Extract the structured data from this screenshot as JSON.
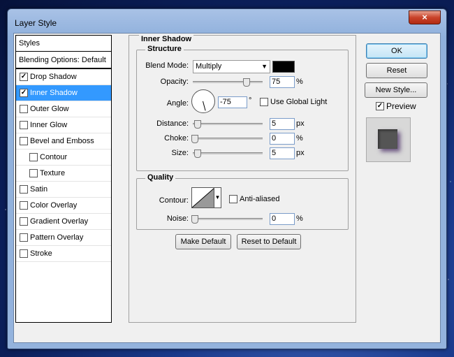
{
  "window": {
    "title": "Layer Style",
    "close_glyph": "×"
  },
  "style_list": {
    "header": "Styles",
    "blending_options": "Blending Options: Default",
    "items": [
      {
        "label": "Drop Shadow",
        "checked": true,
        "active": false,
        "sub": false
      },
      {
        "label": "Inner Shadow",
        "checked": true,
        "active": true,
        "sub": false
      },
      {
        "label": "Outer Glow",
        "checked": false,
        "active": false,
        "sub": false
      },
      {
        "label": "Inner Glow",
        "checked": false,
        "active": false,
        "sub": false
      },
      {
        "label": "Bevel and Emboss",
        "checked": false,
        "active": false,
        "sub": false
      },
      {
        "label": "Contour",
        "checked": false,
        "active": false,
        "sub": true
      },
      {
        "label": "Texture",
        "checked": false,
        "active": false,
        "sub": true
      },
      {
        "label": "Satin",
        "checked": false,
        "active": false,
        "sub": false
      },
      {
        "label": "Color Overlay",
        "checked": false,
        "active": false,
        "sub": false
      },
      {
        "label": "Gradient Overlay",
        "checked": false,
        "active": false,
        "sub": false
      },
      {
        "label": "Pattern Overlay",
        "checked": false,
        "active": false,
        "sub": false
      },
      {
        "label": "Stroke",
        "checked": false,
        "active": false,
        "sub": false
      }
    ]
  },
  "inner_shadow": {
    "section_title": "Inner Shadow",
    "structure": {
      "title": "Structure",
      "blend_mode_label": "Blend Mode:",
      "blend_mode_value": "Multiply",
      "blend_color": "#000000",
      "opacity_label": "Opacity:",
      "opacity_value": "75",
      "opacity_unit": "%",
      "opacity_fraction": 0.75,
      "angle_label": "Angle:",
      "angle_value": "-75",
      "angle_unit": "°",
      "use_global_light_label": "Use Global Light",
      "use_global_light_checked": false,
      "distance_label": "Distance:",
      "distance_value": "5",
      "distance_unit": "px",
      "choke_label": "Choke:",
      "choke_value": "0",
      "choke_unit": "%",
      "size_label": "Size:",
      "size_value": "5",
      "size_unit": "px"
    },
    "quality": {
      "title": "Quality",
      "contour_label": "Contour:",
      "anti_aliased_label": "Anti-aliased",
      "anti_aliased_checked": false,
      "noise_label": "Noise:",
      "noise_value": "0",
      "noise_unit": "%"
    },
    "make_default_label": "Make Default",
    "reset_default_label": "Reset to Default"
  },
  "actions": {
    "ok_label": "OK",
    "reset_label": "Reset",
    "new_style_label": "New Style...",
    "preview_label": "Preview",
    "preview_checked": true
  }
}
